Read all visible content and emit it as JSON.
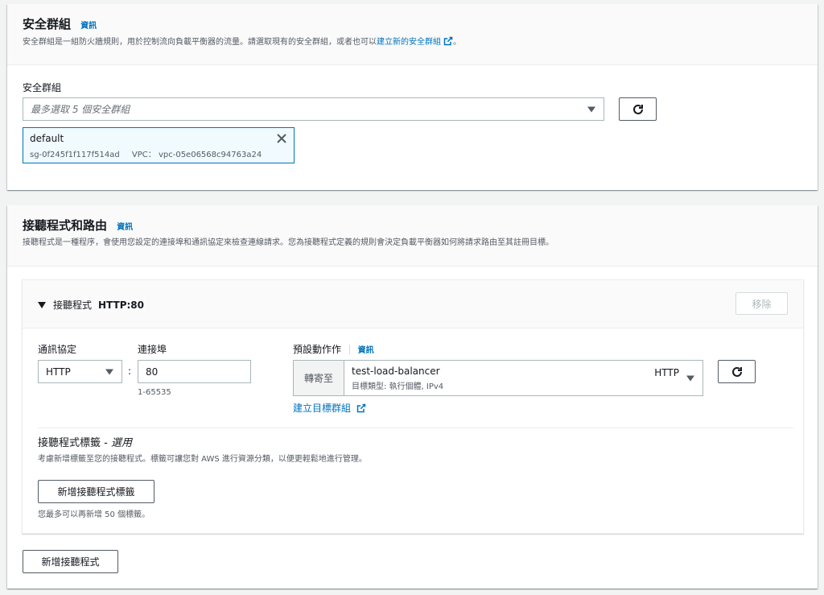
{
  "security_groups": {
    "title": "安全群組",
    "info": "資訊",
    "desc_prefix": "安全群組是一組防火牆規則，用於控制流向負載平衡器的流量。請選取現有的安全群組，或者也可以",
    "desc_link": "建立新的安全群組",
    "desc_suffix": "。",
    "field_label": "安全群組",
    "placeholder": "最多選取 5 個安全群組",
    "selected": {
      "name": "default",
      "id": "sg-0f245f1f117f514ad",
      "vpc_label": "VPC：",
      "vpc": "vpc-05e06568c94763a24"
    }
  },
  "listeners": {
    "title": "接聽程式和路由",
    "info": "資訊",
    "desc": "接聽程式是一種程序，會使用您設定的連接埠和通訊協定來檢查連線請求。您為接聽程式定義的規則會決定負載平衡器如何將請求路由至其註冊目標。",
    "listener": {
      "toggle_label": "接聽程式",
      "name": "HTTP:80",
      "remove_label": "移除",
      "protocol_label": "通訊協定",
      "protocol_value": "HTTP",
      "port_label": "連接埠",
      "port_value": "80",
      "port_hint": "1-65535",
      "default_action_label": "預設動作作",
      "default_action_info": "資訊",
      "forward_to": "轉寄至",
      "target_group_name": "test-load-balancer",
      "target_group_protocol": "HTTP",
      "target_group_sub": "目標類型: 執行個體, IPv4",
      "create_target_group": "建立目標群組",
      "tags_title": "接聽程式標籤 - ",
      "tags_optional": "選用",
      "tags_desc": "考慮新增標籤至您的接聽程式。標籤可讓您對 AWS 進行資源分類，以便更輕鬆地進行管理。",
      "add_tag_button": "新增接聽程式標籤",
      "tag_limit": "您最多可以再新增 50 個標籤。"
    },
    "add_listener_button": "新增接聽程式"
  },
  "colors": {
    "link": "#0073bb",
    "border": "#aab7b8",
    "text_secondary": "#545b64"
  }
}
